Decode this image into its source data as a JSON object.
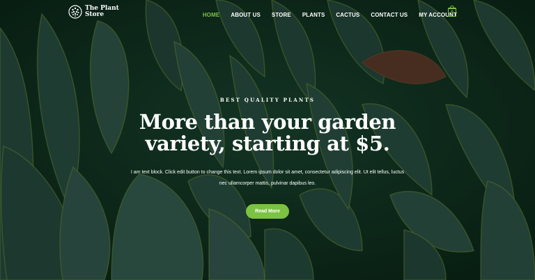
{
  "header": {
    "logo_text": "The Plant Store",
    "nav": [
      {
        "label": "HOME",
        "active": true
      },
      {
        "label": "ABOUT US"
      },
      {
        "label": "STORE"
      },
      {
        "label": "PLANTS"
      },
      {
        "label": "CACTUS"
      },
      {
        "label": "CONTACT US"
      },
      {
        "label": "MY ACCOUNT"
      }
    ],
    "cart_count": "0"
  },
  "hero": {
    "eyebrow": "BEST QUALITY PLANTS",
    "headline": "More than your garden variety, starting at $5.",
    "body": "I am text block. Click edit button to change this text. Lorem ipsum dolor sit amet, consectetur adipiscing elit. Ut elit tellus, luctus nec ullamcorper mattis, pulvinar dapibus leo.",
    "cta_label": "Read More"
  },
  "colors": {
    "accent": "#7cc243",
    "background": "#0f2a1c",
    "text": "#ffffff"
  },
  "icons": {
    "logo": "leaf-circle-logo-icon",
    "cart": "shopping-bag-icon"
  }
}
